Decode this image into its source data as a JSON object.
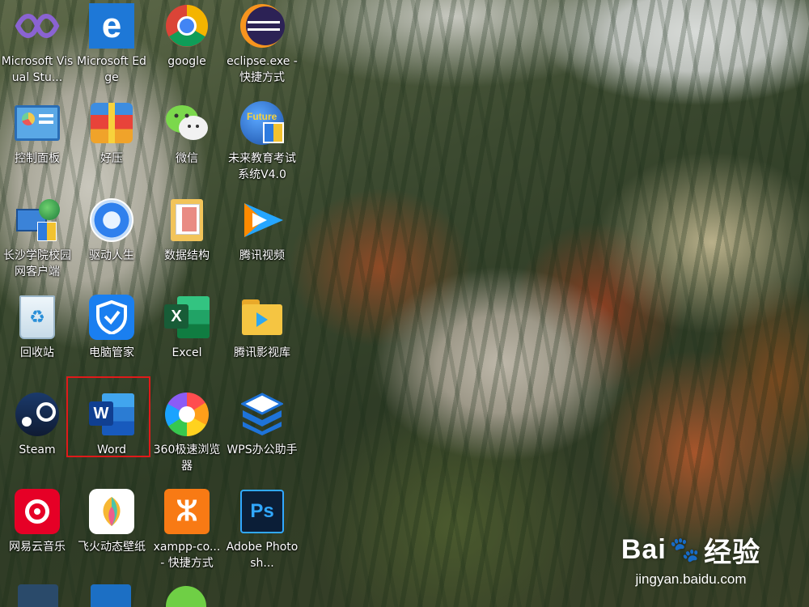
{
  "desktop": {
    "icons": [
      {
        "label": "Microsoft Visual Stu...",
        "icon": "visual-studio-icon"
      },
      {
        "label": "Microsoft Edge",
        "icon": "edge-icon"
      },
      {
        "label": "google",
        "icon": "chrome-icon"
      },
      {
        "label": "eclipse.exe - 快捷方式",
        "icon": "eclipse-icon"
      },
      {
        "label": "控制面板",
        "icon": "control-panel-icon"
      },
      {
        "label": "好压",
        "icon": "haozip-icon"
      },
      {
        "label": "微信",
        "icon": "wechat-icon"
      },
      {
        "label": "未来教育考试系统V4.0",
        "icon": "future-education-icon"
      },
      {
        "label": "长沙学院校园网客户端",
        "icon": "campus-network-icon"
      },
      {
        "label": "驱动人生",
        "icon": "driver-gear-icon"
      },
      {
        "label": "数据结构",
        "icon": "folder-icon"
      },
      {
        "label": "腾讯视频",
        "icon": "tencent-video-icon"
      },
      {
        "label": "回收站",
        "icon": "recycle-bin-icon"
      },
      {
        "label": "电脑管家",
        "icon": "pc-manager-shield-icon"
      },
      {
        "label": "Excel",
        "icon": "excel-icon"
      },
      {
        "label": "腾讯影视库",
        "icon": "video-folder-icon"
      },
      {
        "label": "Steam",
        "icon": "steam-icon"
      },
      {
        "label": "Word",
        "icon": "word-icon"
      },
      {
        "label": "360极速浏览器",
        "icon": "360-browser-icon"
      },
      {
        "label": "WPS办公助手",
        "icon": "wps-icon"
      },
      {
        "label": "网易云音乐",
        "icon": "netease-music-icon"
      },
      {
        "label": "飞火动态壁纸",
        "icon": "feihuo-wallpaper-icon"
      },
      {
        "label": "xampp-co... - 快捷方式",
        "icon": "xampp-icon"
      },
      {
        "label": "Adobe Photosh...",
        "icon": "photoshop-icon"
      }
    ],
    "selected": "Word",
    "selection_color": "#e01a1a"
  },
  "watermark": {
    "logo_text_1": "Bai",
    "logo_text_2": "经验",
    "url": "jingyan.baidu.com"
  }
}
